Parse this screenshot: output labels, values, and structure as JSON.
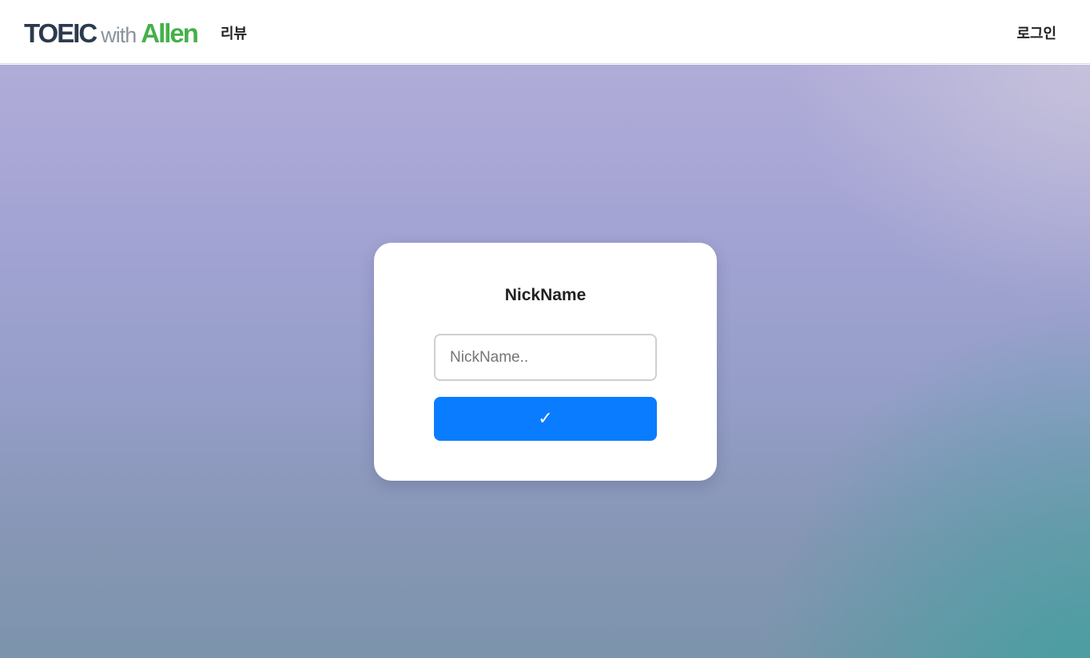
{
  "header": {
    "logo": {
      "part1": "TOEIC",
      "part2": "with",
      "part3": "Allen"
    },
    "nav_review": "리뷰",
    "nav_login": "로그인"
  },
  "card": {
    "title": "NickName",
    "input_placeholder": "NickName..",
    "input_value": "",
    "submit_label": "✓"
  },
  "colors": {
    "logo_dark": "#2b3a4d",
    "logo_gray": "#8a949e",
    "logo_green": "#46b04a",
    "button_blue": "#0a7cff"
  }
}
